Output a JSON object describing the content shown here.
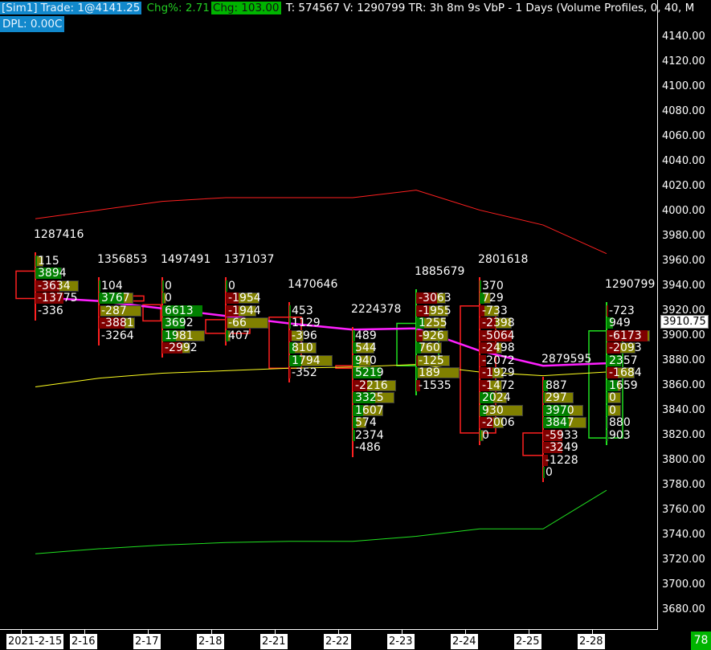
{
  "header": {
    "account": "[Sim1]",
    "trade": "Trade: 1@4141.25",
    "chg_pct": "Chg%: 2.71",
    "chg": "Chg: 103.00",
    "rest": "T: 574567 V: 1290799 TR: 3h 8m 9s VbP - 1 Days   (Volume Profiles, 0, 40, M",
    "dpl": "DPL: 0.00C"
  },
  "colors": {
    "up": "#008000",
    "down": "#800000",
    "volume_bar": "#808000",
    "upper_band": "#ff2020",
    "lower_band": "#20e020",
    "mid_line": "#ffff20",
    "vwap": "#ff20ff",
    "accent": "#1188cc"
  },
  "price_axis": {
    "labels": [
      "4140.00",
      "4120.00",
      "4100.00",
      "4080.00",
      "4060.00",
      "4040.00",
      "4020.00",
      "4000.00",
      "3980.00",
      "3960.00",
      "3940.00",
      "3920.00",
      "3900.00",
      "3880.00",
      "3860.00",
      "3840.00",
      "3820.00",
      "3800.00",
      "3780.00",
      "3760.00",
      "3740.00",
      "3720.00",
      "3700.00",
      "3680.00"
    ],
    "current_price": "3910.75"
  },
  "corner_badge": "78",
  "chart_data": {
    "type": "volume-profile",
    "ylim": [
      3670,
      4150
    ],
    "row_size": 10,
    "days": [
      {
        "date": "2021-2-15",
        "total": "1287416",
        "dir": "down",
        "top": 3960,
        "rows": [
          [
            "115",
            19
          ],
          [
            "3894",
            61
          ],
          [
            "-3634",
            100
          ],
          [
            "-13775",
            65
          ],
          [
            "-336",
            0
          ]
        ]
      },
      {
        "date": "2-16",
        "total": "1356853",
        "dir": "down",
        "top": 3940,
        "rows": [
          [
            "104",
            4
          ],
          [
            "3767",
            80
          ],
          [
            "-287",
            98
          ],
          [
            "-3881",
            83
          ],
          [
            "-3264",
            0
          ]
        ]
      },
      {
        "date": "2-17",
        "total": "1497491",
        "dir": "down",
        "top": 3940,
        "rows": [
          [
            "0",
            4
          ],
          [
            "0",
            9
          ],
          [
            "6613",
            93
          ],
          [
            "3692",
            52
          ],
          [
            "1981",
            98
          ],
          [
            "-2992",
            65
          ]
        ]
      },
      {
        "date": "2-18",
        "total": "1371037",
        "dir": "down",
        "top": 3940,
        "rows": [
          [
            "0",
            4
          ],
          [
            "-1954",
            78
          ],
          [
            "-1944",
            70
          ],
          [
            "-66",
            98
          ],
          [
            "407",
            11
          ]
        ]
      },
      {
        "date": "2-21",
        "total": "1470646",
        "dir": "down",
        "top": 3920,
        "rows": [
          [
            "453",
            4
          ],
          [
            "1129",
            4
          ],
          [
            "-396",
            33
          ],
          [
            "810",
            63
          ],
          [
            "1794",
            100
          ],
          [
            "-352",
            4
          ]
        ]
      },
      {
        "date": "2-22",
        "total": "2224378",
        "dir": "down",
        "top": 3900,
        "rows": [
          [
            "489",
            6
          ],
          [
            "544",
            50
          ],
          [
            "940",
            43
          ],
          [
            "5219",
            65
          ],
          [
            "-2216",
            100
          ],
          [
            "3325",
            96
          ],
          [
            "1607",
            70
          ],
          [
            "574",
            31
          ],
          [
            "2374",
            6
          ],
          [
            "-486",
            0
          ]
        ]
      },
      {
        "date": "2-23",
        "total": "1885679",
        "dir": "up",
        "top": 3930,
        "rows": [
          [
            "-3063",
            69
          ],
          [
            "-1955",
            74
          ],
          [
            "1255",
            69
          ],
          [
            "-926",
            74
          ],
          [
            "760",
            59
          ],
          [
            "-125",
            78
          ],
          [
            "189",
            100
          ],
          [
            "-1535",
            9
          ]
        ]
      },
      {
        "date": "2-24",
        "total": "2801618",
        "dir": "down",
        "top": 3940,
        "rows": [
          [
            "370",
            4
          ],
          [
            "729",
            26
          ],
          [
            "-733",
            44
          ],
          [
            "-2398",
            74
          ],
          [
            "-5064",
            74
          ],
          [
            "-2498",
            52
          ],
          [
            "-2072",
            15
          ],
          [
            "-1929",
            56
          ],
          [
            "-1472",
            52
          ],
          [
            "2024",
            63
          ],
          [
            "930",
            100
          ],
          [
            "-2006",
            56
          ],
          [
            "0",
            9
          ]
        ]
      },
      {
        "date": "2-25",
        "total": "2879595",
        "dir": "down",
        "top": 3860,
        "rows": [
          [
            "887",
            11
          ],
          [
            "297",
            70
          ],
          [
            "3970",
            93
          ],
          [
            "3847",
            100
          ],
          [
            "-5933",
            44
          ],
          [
            "-3249",
            44
          ],
          [
            "-1228",
            11
          ],
          [
            "0",
            4
          ]
        ]
      },
      {
        "date": "2-28",
        "total": "1290799",
        "dir": "up",
        "top": 3920,
        "rows": [
          [
            "-723",
            4
          ],
          [
            "949",
            15
          ],
          [
            "-6173",
            100
          ],
          [
            "-2093",
            67
          ],
          [
            "2357",
            33
          ],
          [
            "-1684",
            65
          ],
          [
            "1659",
            33
          ],
          [
            "0",
            33
          ],
          [
            "0",
            33
          ],
          [
            "880",
            2
          ],
          [
            "903",
            2
          ]
        ]
      }
    ],
    "lines": {
      "upper_band": [
        3994,
        4001,
        4008,
        4011,
        4011,
        4011,
        4017,
        4001,
        3989,
        3966
      ],
      "mid_line": [
        3859,
        3866,
        3870,
        3872,
        3874,
        3875,
        3877,
        3871,
        3868,
        3871
      ],
      "lower_band": [
        3725,
        3729,
        3732,
        3734,
        3735,
        3735,
        3739,
        3745,
        3745,
        3776
      ],
      "vwap": [
        3931,
        3928,
        3922,
        3916,
        3910,
        3905,
        3906,
        3888,
        3876,
        3878
      ]
    }
  }
}
